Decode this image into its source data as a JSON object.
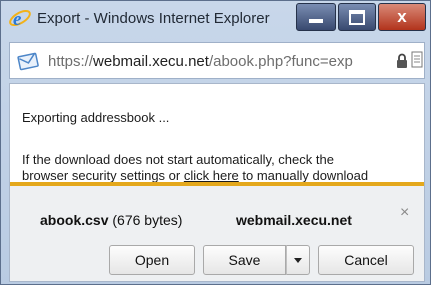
{
  "window": {
    "title": "Export - Windows Internet Explorer",
    "close_glyph": "x"
  },
  "addressbar": {
    "url_prefix": "https://",
    "url_host": "webmail.xecu.net",
    "url_path": "/abook.php?func=exp"
  },
  "content": {
    "status": "Exporting addressbook ...",
    "hint_line1": "If the download does not start automatically, check the",
    "hint_line2_before": "browser security settings or ",
    "hint_link": "click here",
    "hint_line2_after": " to manually download"
  },
  "download_bar": {
    "filename": "abook.csv",
    "filesize": "(676 bytes)",
    "site": "webmail.xecu.net",
    "close_glyph": "×",
    "open_label": "Open",
    "save_label": "Save",
    "cancel_label": "Cancel"
  },
  "colors": {
    "notification_accent": "#e4a81c",
    "titlebar": "#c8d7ea",
    "close_button": "#b2331c"
  },
  "icons": [
    "ie-logo-icon",
    "minimize-icon",
    "maximize-icon",
    "close-icon",
    "mail-icon",
    "lock-icon",
    "page-icon",
    "dropdown-arrow-icon"
  ]
}
